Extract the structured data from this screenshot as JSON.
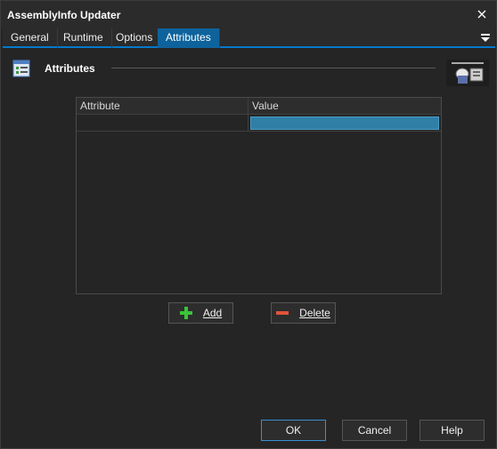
{
  "window": {
    "title": "AssemblyInfo Updater"
  },
  "tabs": [
    {
      "label": "General"
    },
    {
      "label": "Runtime"
    },
    {
      "label": "Options"
    },
    {
      "label": "Attributes"
    }
  ],
  "active_tab": "Attributes",
  "section": {
    "title": "Attributes"
  },
  "grid": {
    "columns": [
      "Attribute",
      "Value"
    ],
    "rows": [
      {
        "attribute": "",
        "value": ""
      }
    ]
  },
  "buttons": {
    "add": "Add",
    "delete": "Delete",
    "ok": "OK",
    "cancel": "Cancel",
    "help": "Help"
  },
  "icons": {
    "close": "close-icon",
    "tab_menu": "menu-icon",
    "section": "list-icon",
    "add": "plus-icon",
    "delete": "minus-icon",
    "brand": "automise-logo"
  },
  "colors": {
    "accent": "#007acc",
    "active_tab": "#0e639c",
    "selected_cell": "#2f7fa6",
    "add_icon": "#3ac43a",
    "delete_icon": "#e0533a"
  }
}
